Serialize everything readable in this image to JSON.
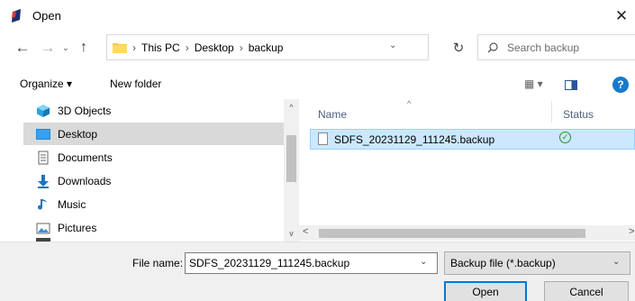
{
  "window": {
    "title": "Open",
    "close_glyph": "✕",
    "icon": "app-icon"
  },
  "nav": {
    "back_glyph": "←",
    "forward_glyph": "→",
    "recent_glyph": "⌄",
    "up_glyph": "↑",
    "refresh_glyph": "↻"
  },
  "address": {
    "crumbs": [
      "This PC",
      "Desktop",
      "backup"
    ],
    "separator": "›",
    "dropdown_glyph": "⌄"
  },
  "search": {
    "placeholder": "Search backup"
  },
  "toolbar": {
    "organize_label": "Organize ▾",
    "new_folder_label": "New folder",
    "view_label": "▦ ▾",
    "help_label": "?"
  },
  "sidebar": {
    "items": [
      {
        "label": "3D Objects",
        "icon": "cube-icon",
        "selected": false
      },
      {
        "label": "Desktop",
        "icon": "desktop-icon",
        "selected": true
      },
      {
        "label": "Documents",
        "icon": "document-icon",
        "selected": false
      },
      {
        "label": "Downloads",
        "icon": "download-icon",
        "selected": false
      },
      {
        "label": "Music",
        "icon": "music-icon",
        "selected": false
      },
      {
        "label": "Pictures",
        "icon": "picture-icon",
        "selected": false
      }
    ]
  },
  "file_list": {
    "columns": [
      "Name",
      "Status"
    ],
    "sort_glyph": "^",
    "rows": [
      {
        "name": "SDFS_20231129_111245.backup",
        "status": "synced",
        "status_glyph": "✓"
      }
    ]
  },
  "scroll": {
    "up_glyph": "^",
    "down_glyph": "v",
    "left_glyph": "<",
    "right_glyph": ">"
  },
  "footer": {
    "filename_label": "File name:",
    "filename_value": "SDFS_20231129_111245.backup",
    "filename_dropdown_glyph": "⌄",
    "filetype_value": "Backup file (*.backup)",
    "filetype_dropdown_glyph": "⌄",
    "open_label": "Open",
    "cancel_label": "Cancel"
  },
  "colors": {
    "selection": "#cce8ff",
    "accent": "#0078d7",
    "column_header": "#4d6082"
  }
}
